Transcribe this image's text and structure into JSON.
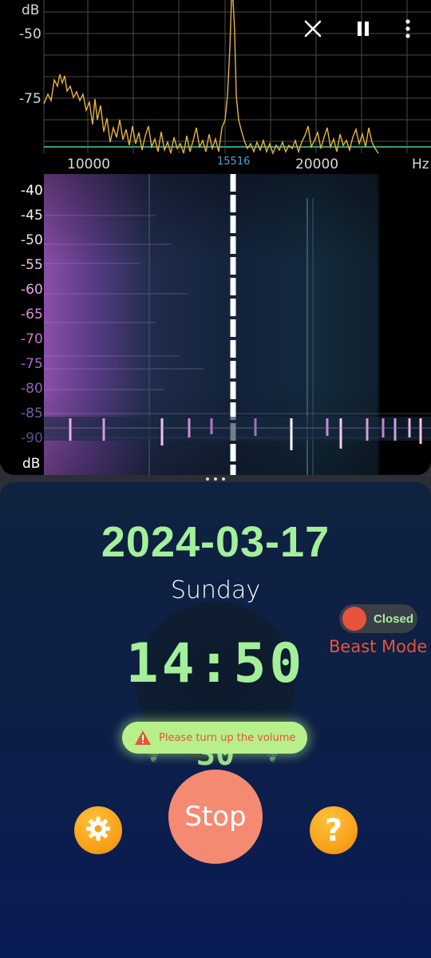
{
  "analyzer": {
    "spectrum": {
      "unit_top": "dB",
      "db_ticks": [
        "-50",
        "-75"
      ],
      "freq_ticks": [
        "10000",
        "20000"
      ],
      "freq_unit": "Hz",
      "peak_freq": "15516",
      "trace_color": "#e8b43c",
      "grid_color": "#555555",
      "noise_floor_color": "#2aa07a"
    },
    "toolbar": {
      "close_icon": "close-icon",
      "pause_icon": "pause-icon",
      "more_icon": "more-vert-icon"
    },
    "waterfall": {
      "db_ticks": [
        "-40",
        "-45",
        "-50",
        "-55",
        "-60",
        "-65",
        "-70",
        "-75",
        "-80",
        "-85",
        "-90"
      ],
      "unit_bottom": "dB"
    }
  },
  "app": {
    "date": "2024-03-17",
    "weekday": "Sunday",
    "time": "14:50",
    "seconds": "30",
    "beast_toggle_label": "Closed",
    "beast_mode_label": "Beast Mode",
    "toast": "Please turn up the volume",
    "stop_label": "Stop",
    "colors": {
      "accent_green": "#a4f09a",
      "beast_red": "#e8533b",
      "stop": "#f58a73",
      "orange": "#f9a21b"
    }
  }
}
